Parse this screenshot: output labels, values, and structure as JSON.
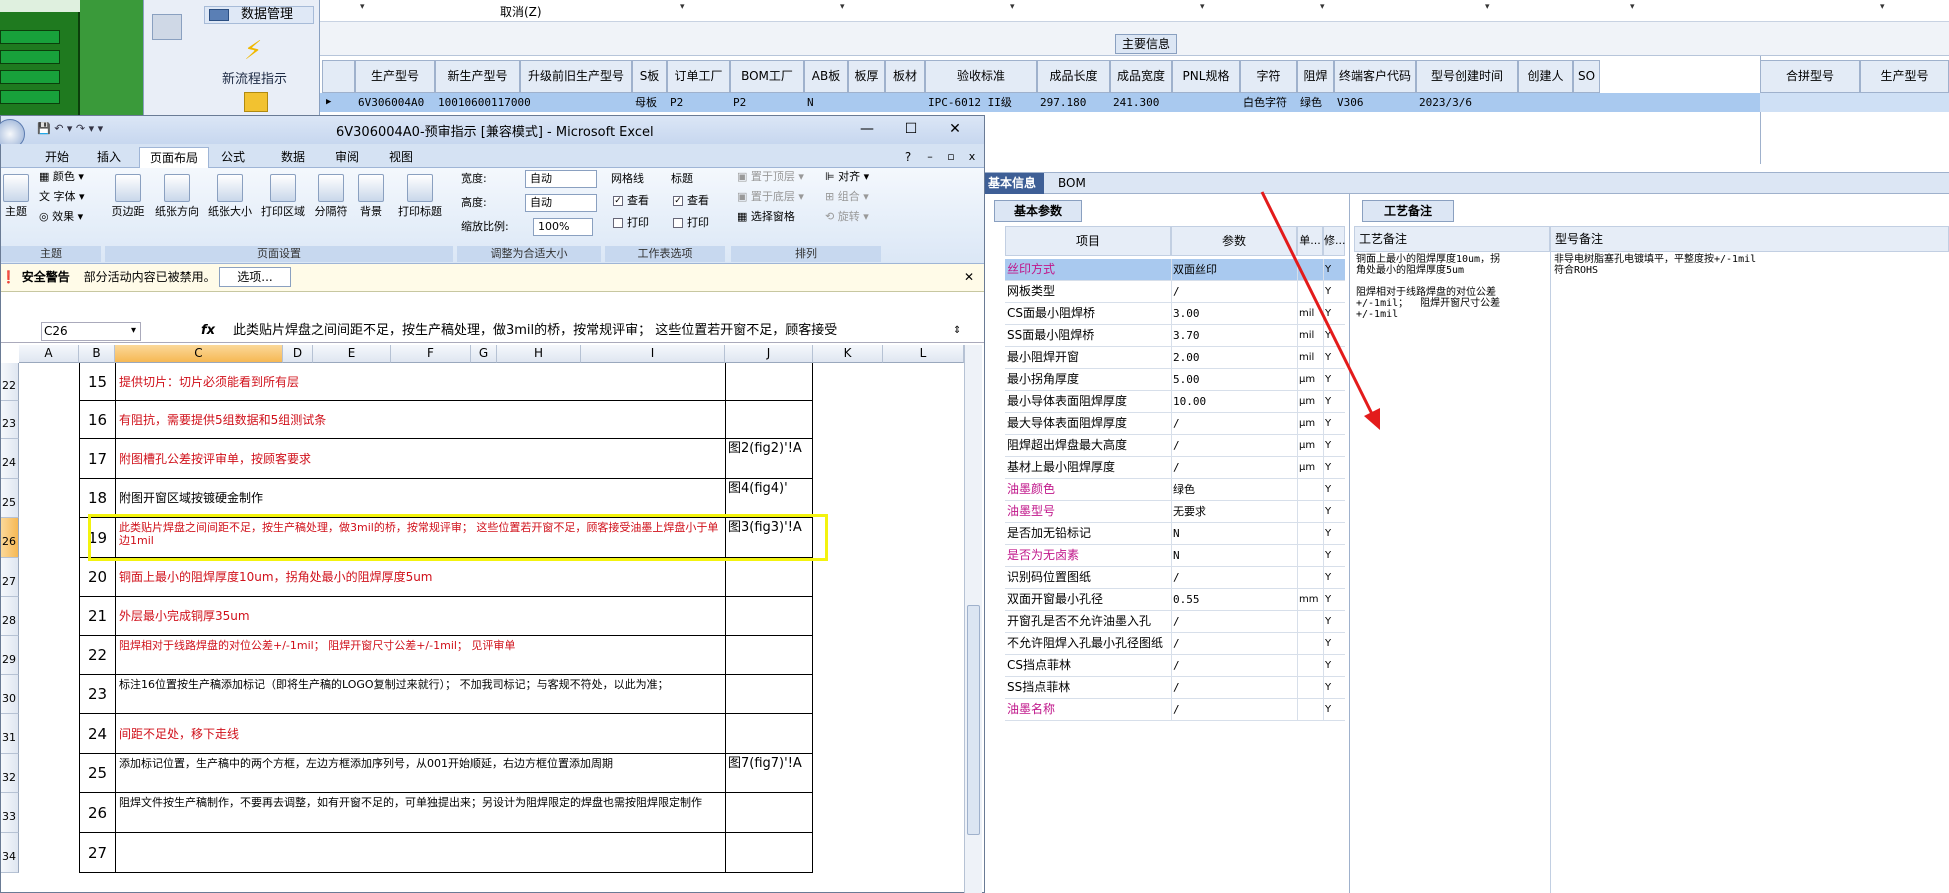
{
  "erp": {
    "nav_top_left": "",
    "nav_data_mgmt": "数据管理",
    "nav_new_flow": "新流程指示",
    "cancel_label": "取消(Z)",
    "main_info_tab": "主要信息",
    "grid_headers": [
      "生产型号",
      "新生产型号",
      "升级前旧生产型号",
      "S板",
      "订单工厂",
      "BOM工厂",
      "AB板",
      "板厚",
      "板材",
      "验收标准",
      "成品长度",
      "成品宽度",
      "PNL规格",
      "字符",
      "阻焊",
      "终端客户代码",
      "型号创建时间",
      "创建人",
      "SO"
    ],
    "grid_row": [
      "6V306004A0",
      "10010600117000",
      "",
      "母板",
      "P2",
      "P2",
      "N",
      "",
      "",
      "IPC-6012 II级",
      "297.180",
      "241.300",
      "",
      "白色字符",
      "绿色",
      "V306",
      "2023/3/6",
      "",
      ""
    ],
    "merge_headers": [
      "合拼型号",
      "生产型号"
    ],
    "tabs": [
      "基本信息",
      "BOM"
    ],
    "basic_sub_tab": "基本参数",
    "param_headers": [
      "项目",
      "参数",
      "单...",
      "修..."
    ],
    "params": [
      {
        "name": "丝印方式",
        "val": "双面丝印",
        "unit": "",
        "y": "Y",
        "pink": true
      },
      {
        "name": "网板类型",
        "val": "/",
        "unit": "",
        "y": "Y",
        "pink": false
      },
      {
        "name": "CS面最小阻焊桥",
        "val": "3.00",
        "unit": "mil",
        "y": "Y",
        "pink": false
      },
      {
        "name": "SS面最小阻焊桥",
        "val": "3.70",
        "unit": "mil",
        "y": "Y",
        "pink": false
      },
      {
        "name": "最小阻焊开窗",
        "val": "2.00",
        "unit": "mil",
        "y": "Y",
        "pink": false
      },
      {
        "name": "最小拐角厚度",
        "val": "5.00",
        "unit": "μm",
        "y": "Y",
        "pink": false
      },
      {
        "name": "最小导体表面阻焊厚度",
        "val": "10.00",
        "unit": "μm",
        "y": "Y",
        "pink": false
      },
      {
        "name": "最大导体表面阻焊厚度",
        "val": "/",
        "unit": "μm",
        "y": "Y",
        "pink": false
      },
      {
        "name": "阻焊超出焊盘最大高度",
        "val": "/",
        "unit": "μm",
        "y": "Y",
        "pink": false
      },
      {
        "name": "基材上最小阻焊厚度",
        "val": "/",
        "unit": "μm",
        "y": "Y",
        "pink": false
      },
      {
        "name": "油墨颜色",
        "val": "绿色",
        "unit": "",
        "y": "Y",
        "pink": true
      },
      {
        "name": "油墨型号",
        "val": "无要求",
        "unit": "",
        "y": "Y",
        "pink": true
      },
      {
        "name": "是否加无铅标记",
        "val": "N",
        "unit": "",
        "y": "Y",
        "pink": false
      },
      {
        "name": "是否为无卤素",
        "val": "N",
        "unit": "",
        "y": "Y",
        "pink": true
      },
      {
        "name": "识别码位置图纸",
        "val": "/",
        "unit": "",
        "y": "Y",
        "pink": false
      },
      {
        "name": "双面开窗最小孔径",
        "val": "0.55",
        "unit": "mm",
        "y": "Y",
        "pink": false
      },
      {
        "name": "开窗孔是否不允许油墨入孔",
        "val": "/",
        "unit": "",
        "y": "Y",
        "pink": false
      },
      {
        "name": "不允许阻焊入孔最小孔径图纸",
        "val": "/",
        "unit": "",
        "y": "Y",
        "pink": false
      },
      {
        "name": "CS挡点菲林",
        "val": "/",
        "unit": "",
        "y": "Y",
        "pink": false
      },
      {
        "name": "SS挡点菲林",
        "val": "/",
        "unit": "",
        "y": "Y",
        "pink": false
      },
      {
        "name": "油墨名称",
        "val": "/",
        "unit": "",
        "y": "Y",
        "pink": true
      }
    ],
    "craft_tab": "工艺备注",
    "craft_headers": [
      "工艺备注",
      "型号备注"
    ],
    "craft_note": "铜面上最小的阻焊厚度10um，拐\n角处最小的阻焊厚度5um\n\n阻焊相对于线路焊盘的对位公差\n+/-1mil；  阻焊开窗尺寸公差\n+/-1mil",
    "model_note": "非导电树脂塞孔电镀填平，平整度按+/-1mil\n符合ROHS"
  },
  "excel": {
    "title": "6V306004A0-预审指示 [兼容模式] - Microsoft Excel",
    "tabs": [
      "开始",
      "插入",
      "页面布局",
      "公式",
      "数据",
      "审阅",
      "视图"
    ],
    "ribbon": {
      "theme": {
        "colors": "颜色",
        "fonts": "字体",
        "effects": "效果",
        "main": "主题",
        "label": "主题"
      },
      "page_setup": {
        "margins": "页边距",
        "orientation": "纸张方向",
        "size": "纸张大小",
        "print_area": "打印区域",
        "breaks": "分隔符",
        "background": "背景",
        "print_titles": "打印标题",
        "label": "页面设置"
      },
      "scale": {
        "width": "宽度:",
        "height": "高度:",
        "scale": "缩放比例:",
        "width_val": "自动",
        "height_val": "自动",
        "scale_val": "100%",
        "label": "调整为合适大小"
      },
      "sheet_opts": {
        "gridlines": "网格线",
        "headings": "标题",
        "view": "查看",
        "print": "打印",
        "label": "工作表选项"
      },
      "arrange": {
        "front": "置于顶层",
        "back": "置于底层",
        "pane": "选择窗格",
        "align": "对齐",
        "group": "组合",
        "rotate": "旋转",
        "label": "排列"
      }
    },
    "security": {
      "title": "安全警告",
      "msg": "部分活动内容已被禁用。",
      "option": "选项..."
    },
    "name_box": "C26",
    "formula": "此类贴片焊盘之间间距不足，按生产稿处理，做3mil的桥，按常规评审；  这些位置若开窗不足，顾客接受",
    "columns": [
      "A",
      "B",
      "C",
      "D",
      "E",
      "F",
      "G",
      "H",
      "I",
      "J",
      "K",
      "L"
    ],
    "row_numbers": [
      "22",
      "23",
      "24",
      "25",
      "26",
      "27",
      "28",
      "29",
      "30",
      "31",
      "32",
      "33",
      "34"
    ],
    "rows": [
      {
        "num": "15",
        "text": "提供切片：切片必须能看到所有层",
        "red": true,
        "j": ""
      },
      {
        "num": "16",
        "text": "有阻抗，需要提供5组数据和5组测试条",
        "red": true,
        "j": ""
      },
      {
        "num": "17",
        "text": "附图槽孔公差按评审单，按顾客要求",
        "red": true,
        "j": "图2(fig2)'!A"
      },
      {
        "num": "18",
        "text": "附图开窗区域按镀硬金制作",
        "red": false,
        "j": "图4(fig4)'"
      },
      {
        "num": "19",
        "text": "此类贴片焊盘之间间距不足，按生产稿处理，做3mil的桥，按常规评审；  这些位置若开窗不足，顾客接受油墨上焊盘小于单边1mil",
        "red": true,
        "j": "图3(fig3)'!A"
      },
      {
        "num": "20",
        "text": "铜面上最小的阻焊厚度10um，拐角处最小的阻焊厚度5um",
        "red": true,
        "j": ""
      },
      {
        "num": "21",
        "text": "外层最小完成铜厚35um",
        "red": true,
        "j": ""
      },
      {
        "num": "22",
        "text": "阻焊相对于线路焊盘的对位公差+/-1mil；  阻焊开窗尺寸公差+/-1mil；  见评审单",
        "red": true,
        "j": ""
      },
      {
        "num": "23",
        "text": "标注16位置按生产稿添加标记（即将生产稿的LOGO复制过来就行）；  不加我司标记；与客规不符处，以此为准；",
        "red": false,
        "j": ""
      },
      {
        "num": "24",
        "text": "间距不足处，移下走线",
        "red": true,
        "j": ""
      },
      {
        "num": "25",
        "text": "添加标记位置，生产稿中的两个方框，左边方框添加序列号，从001开始顺延，右边方框位置添加周期",
        "red": false,
        "j": "图7(fig7)'!A"
      },
      {
        "num": "26",
        "text": "阻焊文件按生产稿制作，不要再去调整，如有开窗不足的，可单独提出来；另设计为阻焊限定的焊盘也需按阻焊限定制作",
        "red": false,
        "j": ""
      },
      {
        "num": "27",
        "text": "",
        "red": false,
        "j": ""
      }
    ]
  },
  "colors": {
    "accent": "#3e5f96",
    "highlight": "#f3f30e",
    "arrow": "#e31b1b",
    "red_text": "#d0101a",
    "pink_text": "#c0168a"
  }
}
